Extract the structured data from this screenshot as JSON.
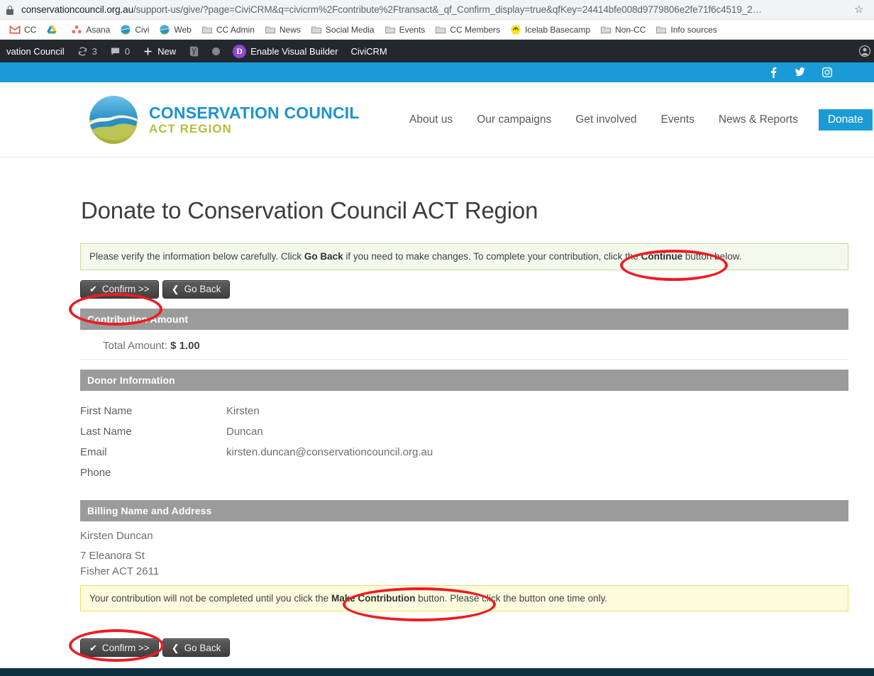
{
  "browser": {
    "url_host": "conservationcouncil.org.au",
    "url_path": "/support-us/give/?page=CiviCRM&q=civicrm%2Fcontribute%2Ftransact&_qf_Confirm_display=true&qfKey=24414bfe008d9779806e2fe71f6c4519_2…",
    "lock_icon": "lock-icon",
    "star_icon": "star-icon",
    "bookmarks": [
      {
        "label": "CC",
        "icon": "gmail-icon"
      },
      {
        "label": "",
        "icon": "google-drive-icon"
      },
      {
        "label": "Asana",
        "icon": "asana-icon"
      },
      {
        "label": "Civi",
        "icon": "conservation-council-icon"
      },
      {
        "label": "Web",
        "icon": "conservation-council-icon"
      },
      {
        "label": "CC Admin",
        "icon": "folder-icon"
      },
      {
        "label": "News",
        "icon": "folder-icon"
      },
      {
        "label": "Social Media",
        "icon": "folder-icon"
      },
      {
        "label": "Events",
        "icon": "folder-icon"
      },
      {
        "label": "CC Members",
        "icon": "folder-icon"
      },
      {
        "label": "Icelab Basecamp",
        "icon": "basecamp-icon"
      },
      {
        "label": "Non-CC",
        "icon": "folder-icon"
      },
      {
        "label": "Info sources",
        "icon": "folder-icon"
      }
    ]
  },
  "adminbar": {
    "site_name": "vation Council",
    "updates_count": "3",
    "comments_count": "0",
    "new_label": "New",
    "divi_badge": "D",
    "visual_builder": "Enable Visual Builder",
    "civicrm": "CiviCRM"
  },
  "social": [
    {
      "name": "facebook-icon"
    },
    {
      "name": "twitter-icon"
    },
    {
      "name": "instagram-icon"
    }
  ],
  "header": {
    "logo_line1": "CONSERVATION COUNCIL",
    "logo_line2": "ACT REGION",
    "nav": [
      {
        "label": "About us"
      },
      {
        "label": "Our campaigns"
      },
      {
        "label": "Get involved"
      },
      {
        "label": "Events"
      },
      {
        "label": "News & Reports"
      }
    ],
    "donate_label": "Donate",
    "search_icon": "search-icon"
  },
  "page": {
    "title": "Donate to Conservation Council ACT Region",
    "alert_green": {
      "part1": "Please verify the information below carefully. Click ",
      "bold1": "Go Back",
      "part2": " if you need to make changes. To complete your contribution, click the ",
      "bold2": "Continue",
      "part3": " button below."
    },
    "alert_yellow": {
      "part1": "Your contribution will not be completed until you click the ",
      "bold1": "Make Contribution",
      "part2": " button. Please click the button one time only."
    },
    "buttons": {
      "confirm_label": "Confirm >>",
      "goback_label": "Go Back",
      "confirm_icon": "check-icon",
      "goback_icon": "chevron-left-icon"
    },
    "sections": [
      {
        "title": "Contribution Amount",
        "total_label": "Total Amount:",
        "total_value": "$ 1.00"
      },
      {
        "title": "Donor Information",
        "fields": [
          {
            "label": "First Name",
            "value": "Kirsten"
          },
          {
            "label": "Last Name",
            "value": "Duncan"
          },
          {
            "label": "Email",
            "value": "kirsten.duncan@conservationcouncil.org.au"
          },
          {
            "label": "Phone",
            "value": ""
          }
        ]
      },
      {
        "title": "Billing Name and Address",
        "billing_name": "Kirsten Duncan",
        "billing_line1": "7 Eleanora St",
        "billing_line2": "Fisher ACT 2611"
      }
    ]
  },
  "colors": {
    "brand_blue": "#1a9bd7",
    "logo_green": "#b5bd3c",
    "annotation_red": "#ed1c24",
    "section_gray": "#9b9b9b",
    "admin_dark": "#23282d",
    "footer_navy": "#0d3040"
  }
}
